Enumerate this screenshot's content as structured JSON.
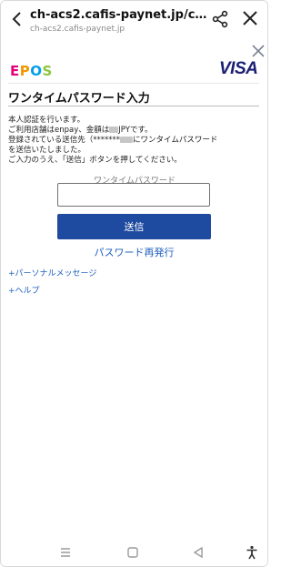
{
  "browser": {
    "title": "ch-acs2.cafis-paynet.jp/creq/...",
    "domain": "ch-acs2.cafis-paynet.jp"
  },
  "header": {
    "epos_logo": {
      "letters": [
        "E",
        "P",
        "O",
        "S"
      ],
      "colors": [
        "#e6007e",
        "#f39800",
        "#009fe8",
        "#8cc63f"
      ]
    },
    "visa_logo": "VISA",
    "title": "ワンタイムパスワード入力"
  },
  "message": {
    "line1": "本人認証を行います。",
    "line2_prefix": "ご利用店舗はenpay、金額は",
    "line2_suffix": "JPYです。",
    "line3_prefix": "登録されている送信先（*******",
    "line3_suffix": "にワンタイムパスワード",
    "line4": "を送信いたしました。",
    "line5": "ご入力のうえ、「送信」ボタンを押してください。"
  },
  "form": {
    "otp_label": "ワンタイムパスワード",
    "otp_value": "",
    "submit_label": "送信",
    "reissue_label": "パスワード再発行"
  },
  "links": {
    "personal_message": "+パーソナルメッセージ",
    "help": "+ヘルプ"
  },
  "colors": {
    "accent": "#1e4aa0",
    "link": "#1f5fbf",
    "visa": "#1a1f71"
  },
  "icons": [
    "back-arrow-icon",
    "share-icon",
    "close-icon",
    "menu-icon",
    "home-icon",
    "back-triangle-icon",
    "accessibility-icon"
  ]
}
